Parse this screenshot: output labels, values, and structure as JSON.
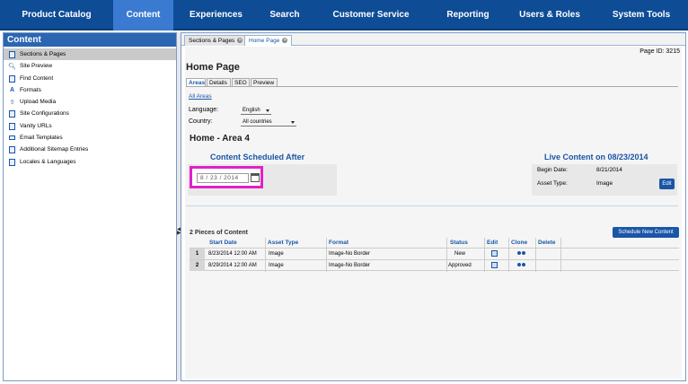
{
  "nav": {
    "items": [
      {
        "label": "Product Catalog",
        "active": false
      },
      {
        "label": "Content",
        "active": true
      },
      {
        "label": "Experiences",
        "active": false
      },
      {
        "label": "Search",
        "active": false
      },
      {
        "label": "Customer Service",
        "active": false
      },
      {
        "label": "Reporting",
        "active": false
      },
      {
        "label": "Users & Roles",
        "active": false
      },
      {
        "label": "System Tools",
        "active": false
      }
    ]
  },
  "sidebar": {
    "title": "Content",
    "items": [
      {
        "label": "Sections & Pages",
        "icon": "document-icon",
        "active": true
      },
      {
        "label": "Site Preview",
        "icon": "magnifier-icon",
        "active": false
      },
      {
        "label": "Find Content",
        "icon": "document-icon",
        "active": false
      },
      {
        "label": "Formats",
        "icon": "format-icon",
        "active": false
      },
      {
        "label": "Upload Media",
        "icon": "upload-icon",
        "active": false
      },
      {
        "label": "Site Configurations",
        "icon": "document-icon",
        "active": false
      },
      {
        "label": "Vanity URLs",
        "icon": "document-icon",
        "active": false
      },
      {
        "label": "Email Templates",
        "icon": "envelope-icon",
        "active": false
      },
      {
        "label": "Additional Sitemap Entries",
        "icon": "document-icon",
        "active": false
      },
      {
        "label": "Locales & Languages",
        "icon": "document-icon",
        "active": false
      }
    ]
  },
  "doctabs": [
    {
      "label": "Sections & Pages",
      "active": false
    },
    {
      "label": "Home Page",
      "active": true
    }
  ],
  "page": {
    "id_label": "Page ID: 3215",
    "title": "Home Page",
    "subtabs": [
      "Areas",
      "Details",
      "SEO",
      "Preview"
    ],
    "all_areas_link": "All Areas",
    "language_label": "Language:",
    "language_value": "English",
    "country_label": "Country:",
    "country_value": "All countries",
    "area_title": "Home - Area 4"
  },
  "scheduled": {
    "title": "Content Scheduled After",
    "date_value": "8  /  23  /  2014"
  },
  "live": {
    "title": "Live Content on 08/23/2014",
    "begin_label": "Begin Date:",
    "begin_value": "8/21/2014",
    "asset_label": "Asset Type:",
    "asset_value": "Image",
    "edit_label": "Edit"
  },
  "pieces": {
    "count_label": "2 Pieces of Content",
    "schedule_button": "Schedule New Content",
    "columns": [
      "Start Date",
      "Asset Type",
      "Format",
      "Status",
      "Edit",
      "Clone",
      "Delete"
    ],
    "rows": [
      {
        "num": "1",
        "start": "8/23/2014 12:00 AM",
        "asset": "Image",
        "format": "Image-No Border",
        "status": "New"
      },
      {
        "num": "2",
        "start": "8/29/2014 12:00 AM",
        "asset": "Image",
        "format": "Image-No Border",
        "status": "Approved"
      }
    ]
  },
  "colors": {
    "nav_bg": "#0e4c96",
    "nav_active": "#3a7ad0",
    "accent": "#1a55a8",
    "highlight": "#e021c8"
  }
}
